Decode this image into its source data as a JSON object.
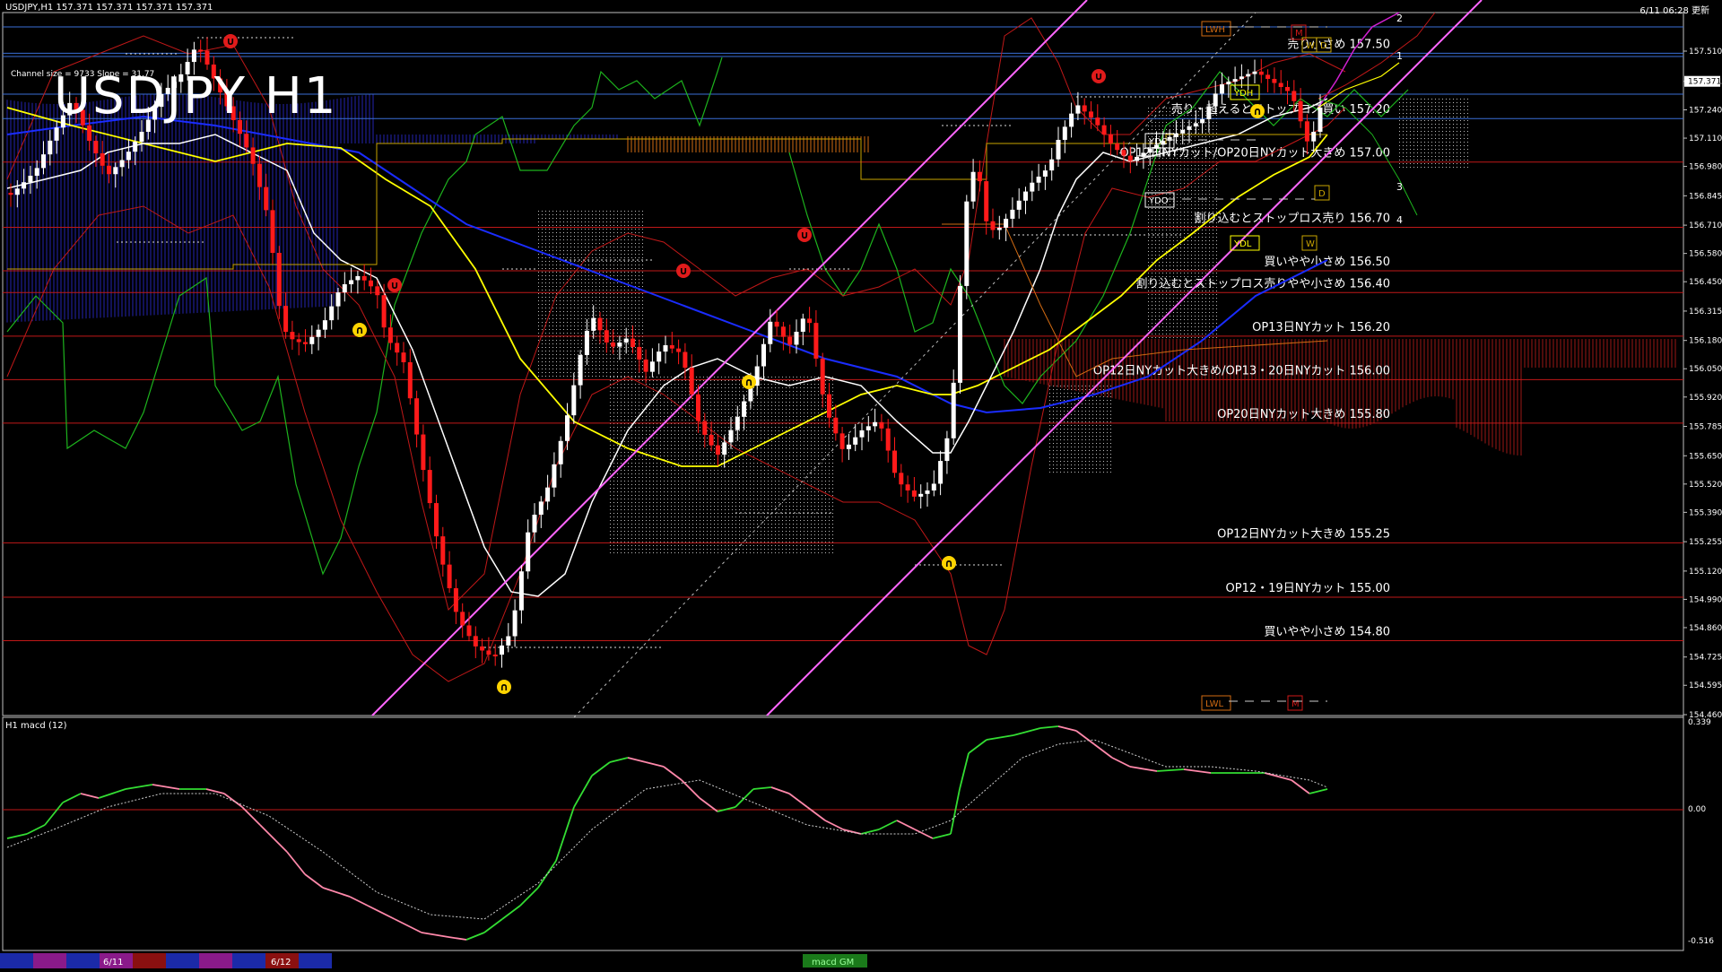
{
  "header": {
    "symbol_line": "USDJPY,H1  157.371 157.371 157.371 157.371",
    "time_line": "6/11 06:28 更新",
    "big_title": "USDJPY H1",
    "channel_info": "Channel size = 9733 Slope = 31.77"
  },
  "price_axis": {
    "ticks": [
      "157.510",
      "157.371",
      "157.240",
      "157.110",
      "156.980",
      "156.845",
      "156.710",
      "156.580",
      "156.450",
      "156.315",
      "156.180",
      "156.050",
      "155.920",
      "155.785",
      "155.650",
      "155.520",
      "155.390",
      "155.255",
      "155.120",
      "154.990",
      "154.860",
      "154.725",
      "154.595",
      "154.460"
    ],
    "current": "157.371"
  },
  "levels": [
    {
      "price": "157.50",
      "label": "売り小さめ 157.50",
      "color": "#3a6ed6"
    },
    {
      "price": "157.20",
      "label": "売り・超えるとストップロス買い 157.20",
      "color": "#3a6ed6"
    },
    {
      "price": "157.00",
      "label": "OP12日NYカット/OP20日NYカット大きめ 157.00",
      "color": "#c01818"
    },
    {
      "price": "156.70",
      "label": "割り込むとストップロス売り 156.70",
      "color": "#c01818"
    },
    {
      "price": "156.50",
      "label": "買いやや小さめ 156.50",
      "color": "#c01818"
    },
    {
      "price": "156.40",
      "label": "割り込むとストップロス売りやや小さめ 156.40",
      "color": "#c01818"
    },
    {
      "price": "156.20",
      "label": "OP13日NYカット 156.20",
      "color": "#c01818"
    },
    {
      "price": "156.00",
      "label": "OP12日NYカット大きめ/OP13・20日NYカット 156.00",
      "color": "#c01818"
    },
    {
      "price": "155.80",
      "label": "OP20日NYカット大きめ 155.80",
      "color": "#c01818"
    },
    {
      "price": "155.25",
      "label": "OP12日NYカット大きめ 155.25",
      "color": "#c01818"
    },
    {
      "price": "155.00",
      "label": "OP12・19日NYカット 155.00",
      "color": "#c01818"
    },
    {
      "price": "154.80",
      "label": "買いやや小さめ 154.80",
      "color": "#c01818"
    }
  ],
  "markers": {
    "lwh": "LWH",
    "lwl": "LWL",
    "ydh": "YDH",
    "ydc": "YDC",
    "ydo": "YDO",
    "ydl": "YDL",
    "m": "M",
    "w": "W",
    "d": "D",
    "channel_nums": [
      "2",
      "1",
      "3",
      "4"
    ]
  },
  "macd": {
    "title": "H1  macd (12)",
    "ticks": [
      "0.339",
      "0.00",
      "-0.516"
    ],
    "volume_tick": "20000"
  },
  "bottom_tabs": {
    "dates": [
      "6/11",
      "6/12"
    ],
    "indicator_label": "macd GM"
  },
  "colors": {
    "background": "#000000",
    "bull_candle": "#ffffff",
    "bear_candle": "#ff1a1a",
    "ma_short": "#ffffff",
    "ma_mid": "#ffff00",
    "ma_long": "#1a2cff",
    "channel": "#ff66ff",
    "chikou": "#00cc00",
    "macd_up": "#33dd33",
    "macd_down": "#ff88aa"
  },
  "chart_data": {
    "type": "candlestick",
    "title": "USDJPY H1",
    "ylim": [
      154.46,
      157.51
    ]
  }
}
